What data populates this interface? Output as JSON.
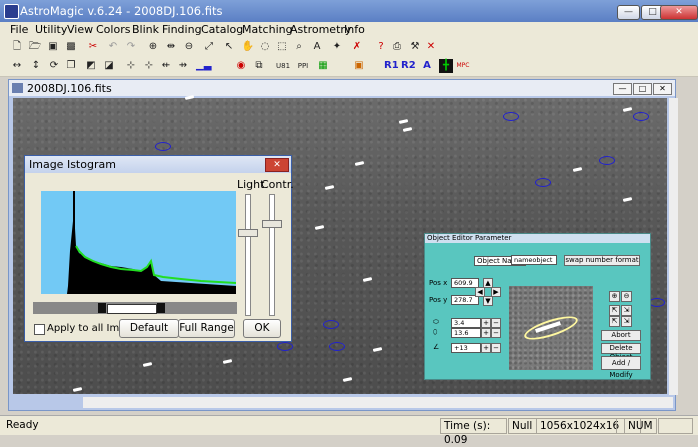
{
  "app": {
    "title": "AstroMagic v.6.24 - 2008DJ.106.fits"
  },
  "window_buttons": {
    "min": "—",
    "max": "□",
    "close": "✕"
  },
  "menu": [
    "File",
    "Utility",
    "View",
    "Colors",
    "Blink",
    "Finding",
    "Catalog",
    "Matching",
    "Astrometry",
    "Info"
  ],
  "toolbar2_labels": {
    "u81": "U81",
    "ppi": "PPI",
    "r1": "R1",
    "r2": "R2",
    "a": "A",
    "mpc": "MPC"
  },
  "child": {
    "title": "2008DJ.106.fits"
  },
  "histogram": {
    "title": "Image Istogram",
    "light_label": "Light",
    "contr_label": "Contr.",
    "apply_all": "Apply to all Images",
    "default_btn": "Default",
    "full_range_btn": "Full Range",
    "ok_btn": "OK",
    "colors": {
      "bg": "#72c9f5",
      "fill": "#000000",
      "curve": "#22dd22"
    }
  },
  "object_editor": {
    "title": "Object Editor Parameter",
    "object_name_label": "Object Name",
    "object_name_value": "nameobject",
    "swap_btn": "swap number format",
    "pos_x_label": "Pos x",
    "pos_x_value": "609.9",
    "pos_y_label": "Pos y",
    "pos_y_value": "278.7",
    "size1_value": "3.4",
    "size2_value": "13.6",
    "angle_value": "+13",
    "abort_btn": "Abort",
    "delete_btn": "Delete Object",
    "add_btn": "Add / Modify"
  },
  "status": {
    "ready": "Ready",
    "time": "Time (s): 0.09",
    "null": "Null",
    "size": "1056x1024x16",
    "num": "NUM"
  }
}
